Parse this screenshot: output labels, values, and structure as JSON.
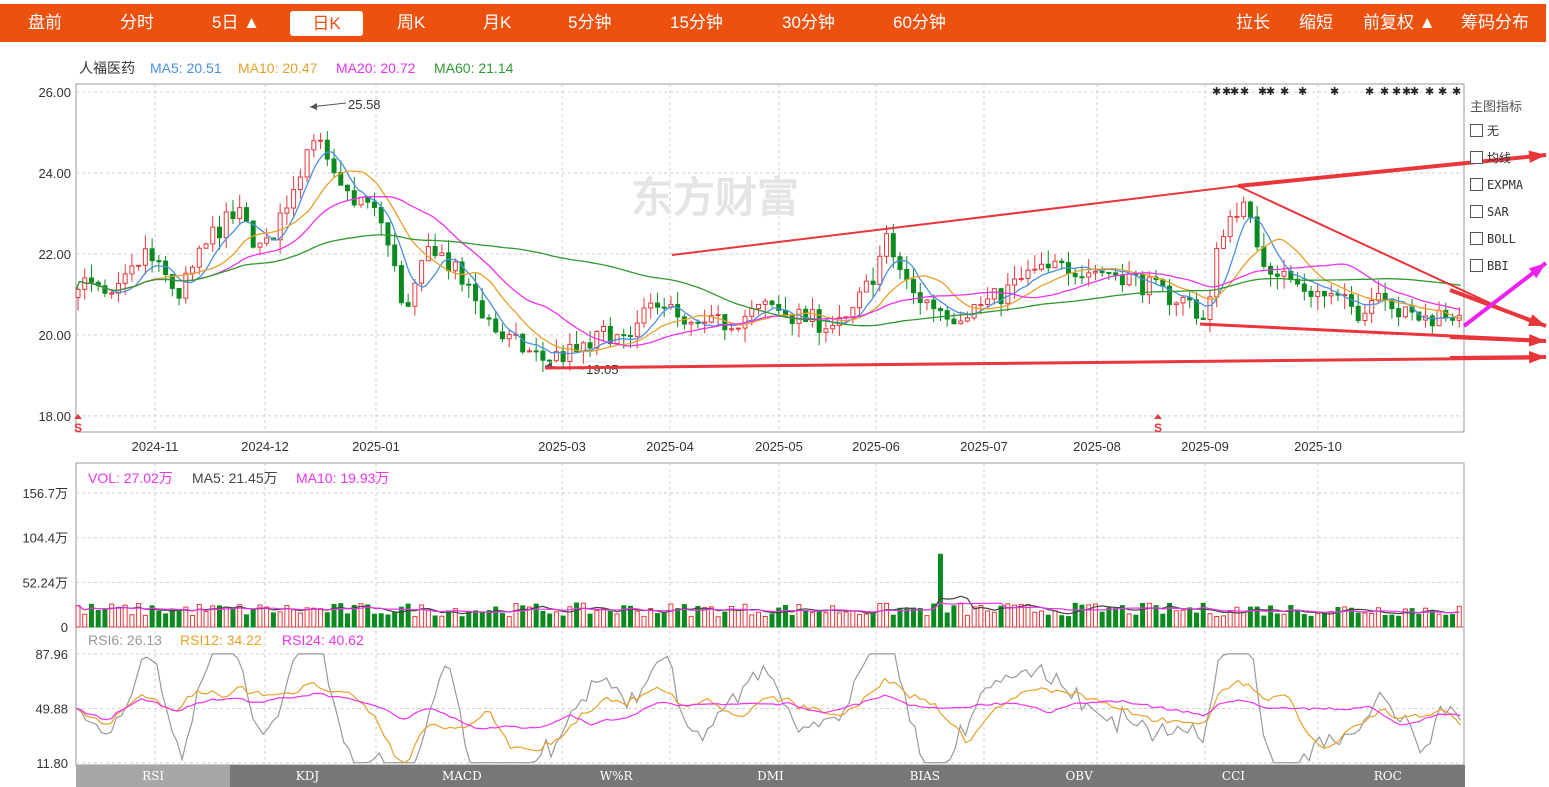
{
  "topbar": {
    "left_tabs": [
      "盘前",
      "分时",
      "5日 ▲",
      "日K",
      "周K",
      "月K",
      "5分钟",
      "15分钟",
      "30分钟",
      "60分钟"
    ],
    "active": "日K",
    "right_tabs": [
      "拉长",
      "缩短",
      "前复权 ▲",
      "筹码分布"
    ],
    "color": "#ec5110"
  },
  "main": {
    "stock_name": "人福医药",
    "ma": [
      {
        "label": "MA5: 20.51",
        "color": "#4a8fe0"
      },
      {
        "label": "MA10: 20.47",
        "color": "#e8a02a"
      },
      {
        "label": "MA20: 20.72",
        "color": "#ee33ee"
      },
      {
        "label": "MA60: 21.14",
        "color": "#2f9a2f"
      }
    ],
    "y_ticks": [
      "26.00",
      "24.00",
      "22.00",
      "20.00",
      "18.00"
    ],
    "x_ticks": [
      "2024-11",
      "2024-12",
      "2025-01",
      "2025-03",
      "2025-04",
      "2025-05",
      "2025-06",
      "2025-07",
      "2025-08",
      "2025-09",
      "2025-10"
    ],
    "high_label": "25.58",
    "low_label": "19.05",
    "watermark": "东方财富",
    "signal_marker": "S"
  },
  "side_panel": {
    "title": "主图指标",
    "options": [
      "无",
      "均线",
      "EXPMA",
      "SAR",
      "BOLL",
      "BBI"
    ]
  },
  "volume": {
    "legend": [
      {
        "label": "VOL: 27.02万",
        "color": "#ee33ee"
      },
      {
        "label": "MA5: 21.45万",
        "color": "#444444"
      },
      {
        "label": "MA10: 19.93万",
        "color": "#ee33ee"
      }
    ],
    "y_ticks": [
      "156.7万",
      "104.4万",
      "52.24万",
      "0"
    ]
  },
  "rsi": {
    "legend": [
      {
        "label": "RSI6: 26.13",
        "color": "#999999"
      },
      {
        "label": "RSI12: 34.22",
        "color": "#e8a02a"
      },
      {
        "label": "RSI24: 40.62",
        "color": "#ee33ee"
      }
    ],
    "y_ticks": [
      "87.96",
      "49.88",
      "11.80"
    ]
  },
  "indicator_tabs": [
    "RSI",
    "KDJ",
    "MACD",
    "W%R",
    "DMI",
    "BIAS",
    "OBV",
    "CCI",
    "ROC"
  ],
  "indicator_active": "RSI",
  "chart_data": {
    "type": "candlestick",
    "title": "人福医药",
    "ylim": [
      17.6,
      26.2
    ],
    "x_axis": [
      "2024-11",
      "2024-12",
      "2025-01",
      "2025-03",
      "2025-04",
      "2025-05",
      "2025-06",
      "2025-07",
      "2025-08",
      "2025-09",
      "2025-10"
    ],
    "price_path": [
      [
        0,
        21.4
      ],
      [
        20,
        20.8
      ],
      [
        40,
        22.0
      ],
      [
        60,
        21.0
      ],
      [
        80,
        22.5
      ],
      [
        95,
        23.0
      ],
      [
        110,
        22.0
      ],
      [
        125,
        23.4
      ],
      [
        140,
        25.0
      ],
      [
        155,
        23.5
      ],
      [
        170,
        23.3
      ],
      [
        180,
        22.8
      ],
      [
        195,
        20.5
      ],
      [
        210,
        22.3
      ],
      [
        230,
        21.2
      ],
      [
        250,
        20.0
      ],
      [
        275,
        19.4
      ],
      [
        300,
        19.6
      ],
      [
        315,
        20.1
      ],
      [
        325,
        19.7
      ],
      [
        345,
        21.0
      ],
      [
        360,
        20.1
      ],
      [
        385,
        20.3
      ],
      [
        410,
        20.7
      ],
      [
        430,
        20.4
      ],
      [
        455,
        20.2
      ],
      [
        470,
        21.3
      ],
      [
        480,
        22.3
      ],
      [
        495,
        21.0
      ],
      [
        520,
        20.5
      ],
      [
        545,
        20.9
      ],
      [
        565,
        21.5
      ],
      [
        590,
        21.7
      ],
      [
        620,
        21.5
      ],
      [
        645,
        21.0
      ],
      [
        660,
        20.8
      ],
      [
        670,
        20.3
      ],
      [
        678,
        22.5
      ],
      [
        690,
        23.3
      ],
      [
        705,
        21.8
      ],
      [
        725,
        21.2
      ],
      [
        745,
        20.9
      ],
      [
        760,
        20.6
      ],
      [
        775,
        21.2
      ],
      [
        785,
        20.5
      ],
      [
        800,
        20.4
      ],
      [
        815,
        20.6
      ],
      [
        823,
        20.0
      ]
    ],
    "ma_series": [
      {
        "name": "MA5",
        "value": 20.51,
        "color": "#4a8fe0"
      },
      {
        "name": "MA10",
        "value": 20.47,
        "color": "#e8a02a"
      },
      {
        "name": "MA20",
        "value": 20.72,
        "color": "#ee33ee"
      },
      {
        "name": "MA60",
        "value": 21.14,
        "color": "#2f9a2f"
      }
    ],
    "high": 25.58,
    "low": 19.05,
    "volume": {
      "ylim": [
        0,
        156.7
      ],
      "units": "万",
      "last": 27.02,
      "ma5": 21.45,
      "ma10": 19.93,
      "spikes": [
        [
          128,
          85
        ],
        [
          228,
          65
        ],
        [
          339,
          140
        ],
        [
          340,
          100
        ],
        [
          345,
          75
        ]
      ]
    },
    "rsi": {
      "ylim": [
        11.8,
        87.96
      ],
      "rsi6": 26.13,
      "rsi12": 34.22,
      "rsi24": 40.62
    },
    "colors": {
      "up": "#e8363a",
      "down": "#0a8a1f",
      "grid": "#cfcfcf"
    }
  }
}
